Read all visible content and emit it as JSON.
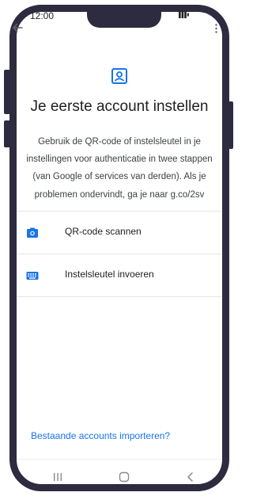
{
  "status_bar": {
    "time": "12:00"
  },
  "header": {
    "icon": "account-box-icon",
    "title": "Je eerste account instellen",
    "description": "Gebruik de QR-code of instelsleutel in je instellingen voor authenticatie in twee stappen (van Google of services van derden). Als je problemen ondervindt, ga je naar g.co/2sv"
  },
  "options": [
    {
      "icon": "camera-icon",
      "label": "QR-code scannen"
    },
    {
      "icon": "keyboard-icon",
      "label": "Instelsleutel invoeren"
    }
  ],
  "footer": {
    "import_link": "Bestaande accounts importeren?"
  },
  "nav_bar": {
    "buttons": [
      "recent-apps-icon",
      "home-icon",
      "back-icon"
    ]
  },
  "colors": {
    "accent": "#1a73e8",
    "frame": "#2d2b3f",
    "text": "#202124"
  }
}
